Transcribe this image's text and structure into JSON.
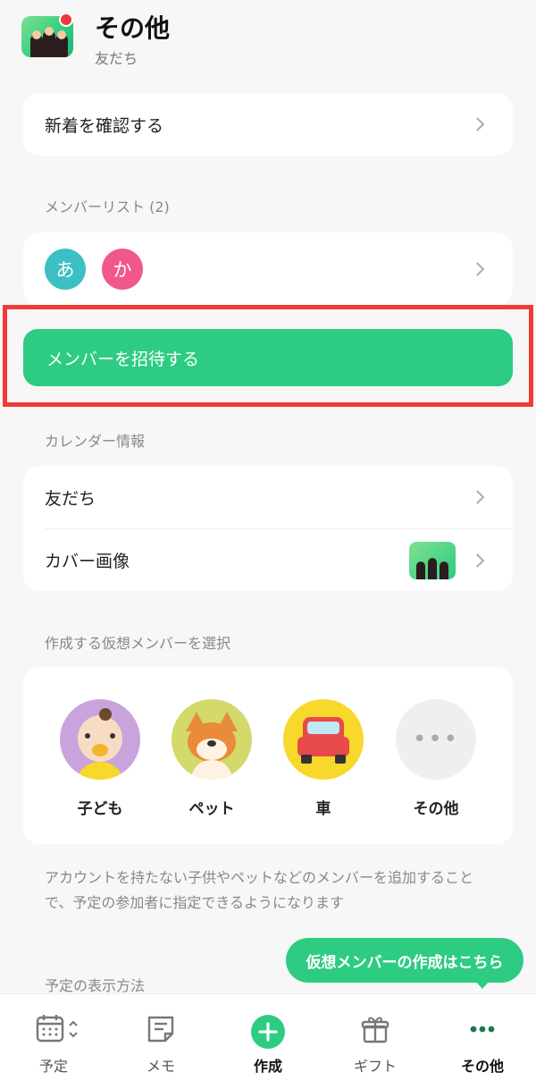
{
  "header": {
    "title": "その他",
    "subtitle": "友だち"
  },
  "whats_new": {
    "label": "新着を確認する"
  },
  "members": {
    "section_label": "メンバーリスト (2)",
    "avatars": [
      {
        "initial": "あ",
        "color": "#3cc0c4"
      },
      {
        "initial": "か",
        "color": "#f0588a"
      }
    ]
  },
  "invite_button": {
    "label": "メンバーを招待する"
  },
  "calendar_info": {
    "section_label": "カレンダー情報",
    "friends_label": "友だち",
    "cover_label": "カバー画像"
  },
  "virtual_members": {
    "section_label": "作成する仮想メンバーを選択",
    "items": [
      {
        "label": "子ども",
        "icon": "baby-icon",
        "color": "#c9a3dc"
      },
      {
        "label": "ペット",
        "icon": "dog-icon",
        "color": "#d3d96a"
      },
      {
        "label": "車",
        "icon": "car-icon",
        "color": "#f7d82b"
      },
      {
        "label": "その他",
        "icon": "more-icon",
        "color": "#efefef"
      }
    ],
    "note": "アカウントを持たない子供やペットなどのメンバーを追加することで、予定の参加者に指定できるようになります"
  },
  "tooltip": {
    "text": "仮想メンバーの作成はこちら"
  },
  "display_section": {
    "label": "予定の表示方法"
  },
  "tabbar": {
    "items": [
      {
        "label": "予定",
        "icon": "calendar-icon"
      },
      {
        "label": "メモ",
        "icon": "memo-icon"
      },
      {
        "label": "作成",
        "icon": "add-icon"
      },
      {
        "label": "ギフト",
        "icon": "gift-icon"
      },
      {
        "label": "その他",
        "icon": "more-icon"
      }
    ],
    "accent": "#2ecc83"
  }
}
